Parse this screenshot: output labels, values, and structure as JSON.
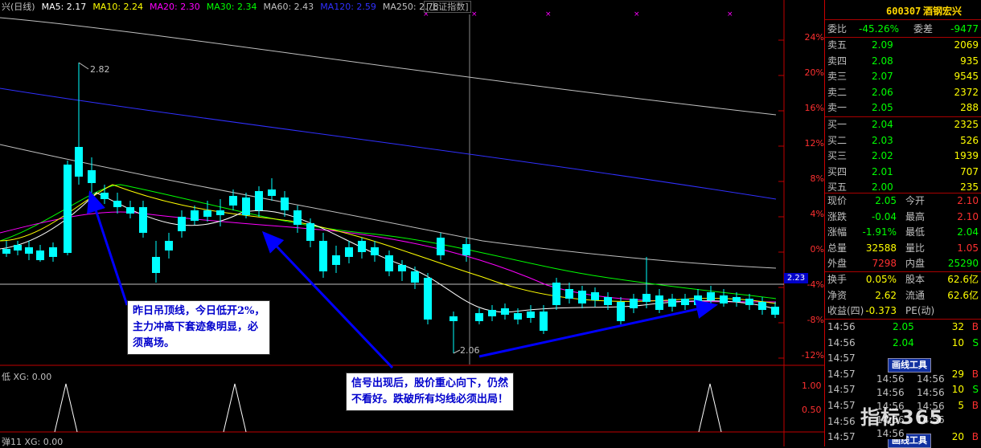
{
  "header": {
    "name_suffix": "兴(日线)",
    "ma": [
      {
        "label": "MA5: 2.17",
        "color": "#ffffff"
      },
      {
        "label": "MA10: 2.24",
        "color": "#ffff00"
      },
      {
        "label": "MA20: 2.30",
        "color": "#ff00ff"
      },
      {
        "label": "MA30: 2.34",
        "color": "#00ff00"
      },
      {
        "label": "MA60: 2.43",
        "color": "#c0c0c0"
      },
      {
        "label": "MA120: 2.59",
        "color": "#3030ff"
      },
      {
        "label": "MA250: 2.78",
        "color": "#c0c0c0"
      }
    ],
    "index_tag": "[上证指数]"
  },
  "axis": {
    "pct_labels": [
      "24%",
      "20%",
      "16%",
      "12%",
      "8%",
      "4%",
      "0%",
      "-4%",
      "-8%",
      "-12%"
    ],
    "current_price_tag": "2.23",
    "sub_labels": [
      "1.00",
      "0.50"
    ]
  },
  "annotations": {
    "high": "2.82",
    "low": "2.06"
  },
  "callouts": {
    "left": [
      "昨日吊顶线，今日低开2%，",
      "主力冲高下套迹象明显，必",
      "须离场。"
    ],
    "right": [
      "信号出现后，股价重心向下，仍然",
      "不看好。跌破所有均线必须出局！"
    ]
  },
  "sub_panels": {
    "xg1": "低 XG: 0.00",
    "xg2": "弹11 XG: 0.00"
  },
  "quote": {
    "code": "600307",
    "name": "酒钢宏兴",
    "webi_label": "委比",
    "webi": "-45.26%",
    "weicha_label": "委差",
    "weicha": "-9477",
    "sell": [
      {
        "label": "卖五",
        "price": "2.09",
        "vol": "2069"
      },
      {
        "label": "卖四",
        "price": "2.08",
        "vol": "935"
      },
      {
        "label": "卖三",
        "price": "2.07",
        "vol": "9545"
      },
      {
        "label": "卖二",
        "price": "2.06",
        "vol": "2372"
      },
      {
        "label": "卖一",
        "price": "2.05",
        "vol": "288"
      }
    ],
    "buy": [
      {
        "label": "买一",
        "price": "2.04",
        "vol": "2325"
      },
      {
        "label": "买二",
        "price": "2.03",
        "vol": "526"
      },
      {
        "label": "买三",
        "price": "2.02",
        "vol": "1939"
      },
      {
        "label": "买四",
        "price": "2.01",
        "vol": "707"
      },
      {
        "label": "买五",
        "price": "2.00",
        "vol": "235"
      }
    ],
    "stats": [
      {
        "l1": "现价",
        "v1": "2.05",
        "l2": "今开",
        "v2": "2.10"
      },
      {
        "l1": "涨跌",
        "v1": "-0.04",
        "l2": "最高",
        "v2": "2.10"
      },
      {
        "l1": "涨幅",
        "v1": "-1.91%",
        "l2": "最低",
        "v2": "2.04"
      },
      {
        "l1": "总量",
        "v1": "32588",
        "l2": "量比",
        "v2": "1.05"
      },
      {
        "l1": "外盘",
        "v1": "7298",
        "l2": "内盘",
        "v2": "25290"
      }
    ],
    "stats2": [
      {
        "l1": "换手",
        "v1": "0.05%",
        "l2": "股本",
        "v2": "62.6亿"
      },
      {
        "l1": "净资",
        "v1": "2.62",
        "l2": "流通",
        "v2": "62.6亿"
      },
      {
        "l1": "收益(四)",
        "v1": "-0.373",
        "l2": "PE(动)",
        "v2": ""
      }
    ],
    "ticks": [
      {
        "t": "14:56",
        "p": "2.05",
        "v": "32",
        "d": "B"
      },
      {
        "t": "14:56",
        "p": "2.04",
        "v": "10",
        "d": "S"
      },
      {
        "t": "14:57",
        "p": "",
        "v": "",
        "d": ""
      },
      {
        "t": "14:57",
        "p": "",
        "v": "29",
        "d": "B"
      },
      {
        "t": "14:57",
        "p": "",
        "v": "10",
        "d": "S"
      },
      {
        "t": "14:57",
        "p": "",
        "v": "5",
        "d": "B"
      },
      {
        "t": "14:56",
        "p": "",
        "v": "",
        "d": ""
      },
      {
        "t": "14:57",
        "p": "",
        "v": "20",
        "d": "B"
      }
    ],
    "tool_label": "画线工具",
    "overlay_ticks": [
      "14:56",
      "14:56",
      "14:56",
      "14:56",
      "14:56"
    ],
    "overlay_ticks2": [
      "14:56",
      "14:56",
      "14:56",
      "14:56"
    ]
  },
  "watermark": "指标365",
  "colors": {
    "up": "#ff3030",
    "down": "#00ffff",
    "panel_border": "#c00000"
  },
  "chart_data": {
    "type": "candlestick",
    "price_range": [
      1.88,
      2.9
    ],
    "high": 2.82,
    "low": 2.06
  }
}
